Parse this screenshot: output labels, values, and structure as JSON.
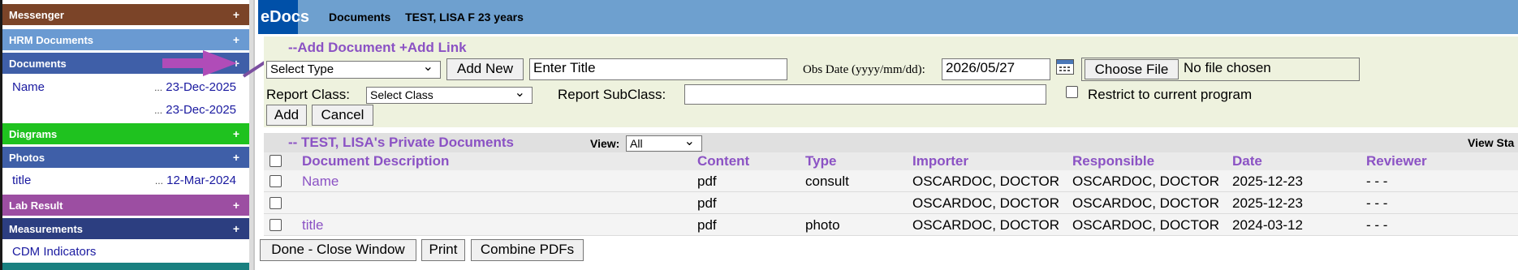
{
  "sidebar": {
    "sections": [
      {
        "title": "Messenger",
        "color": "#7b4428",
        "plus": "+"
      },
      {
        "title": "HRM Documents",
        "color": "#6a9ad2",
        "plus": "+"
      },
      {
        "title": "Documents",
        "color": "#3f5fa8",
        "plus": "+"
      },
      {
        "title": "Diagrams",
        "color": "#1fc21f",
        "plus": "+"
      },
      {
        "title": "Photos",
        "color": "#3f5fa8",
        "plus": "+"
      },
      {
        "title": "Lab Result",
        "color": "#9c4ea2",
        "plus": "+"
      },
      {
        "title": "Measurements",
        "color": "#2c3e80",
        "plus": "+"
      }
    ],
    "documents_items": [
      {
        "name": "Name",
        "dots": "...",
        "date": "23-Dec-2025"
      },
      {
        "name": "",
        "dots": "...",
        "date": "23-Dec-2025"
      }
    ],
    "photos_items": [
      {
        "name": "title",
        "dots": "...",
        "date": "12-Mar-2024"
      }
    ],
    "measurements_items": [
      {
        "name": "CDM Indicators"
      }
    ]
  },
  "topbar": {
    "app_title": "eDocs",
    "module": "Documents",
    "patient": "TEST, LISA F 23 years"
  },
  "add_panel": {
    "add_document": "--Add Document",
    "add_link": "+Add Link",
    "type_select": "Select Type",
    "add_new": "Add New",
    "title_value": "Enter Title",
    "obs_date_label": "Obs Date (yyyy/mm/dd):",
    "obs_date_value": "2026/05/27",
    "choose_file": "Choose File",
    "no_file": "No file chosen",
    "report_class_label": "Report Class:",
    "report_class_select": "Select Class",
    "report_subclass_label": "Report SubClass:",
    "report_subclass_value": "",
    "restrict_label": "Restrict to current program",
    "add_button": "Add",
    "cancel_button": "Cancel"
  },
  "docs": {
    "title": "-- TEST, LISA's Private Documents",
    "view_label": "View:",
    "view_value": "All",
    "view_status": "View Sta",
    "columns": [
      "Document Description",
      "Content",
      "Type",
      "Importer",
      "Responsible",
      "Date",
      "Reviewer"
    ],
    "rows": [
      {
        "description": "Name",
        "content": "pdf",
        "type": "consult",
        "importer": "OSCARDOC, DOCTOR",
        "responsible": "OSCARDOC, DOCTOR",
        "date": "2025-12-23",
        "reviewer": "- - -"
      },
      {
        "description": "",
        "content": "pdf",
        "type": "",
        "importer": "OSCARDOC, DOCTOR",
        "responsible": "OSCARDOC, DOCTOR",
        "date": "2025-12-23",
        "reviewer": "- - -"
      },
      {
        "description": "title",
        "content": "pdf",
        "type": "photo",
        "importer": "OSCARDOC, DOCTOR",
        "responsible": "OSCARDOC, DOCTOR",
        "date": "2024-03-12",
        "reviewer": "- - -"
      }
    ]
  },
  "footer": {
    "done": "Done - Close Window",
    "print": "Print",
    "combine": "Combine PDFs"
  },
  "icons": {
    "calendar": "calendar-icon",
    "annotation_arrow": "arrow-annotation-icon"
  }
}
